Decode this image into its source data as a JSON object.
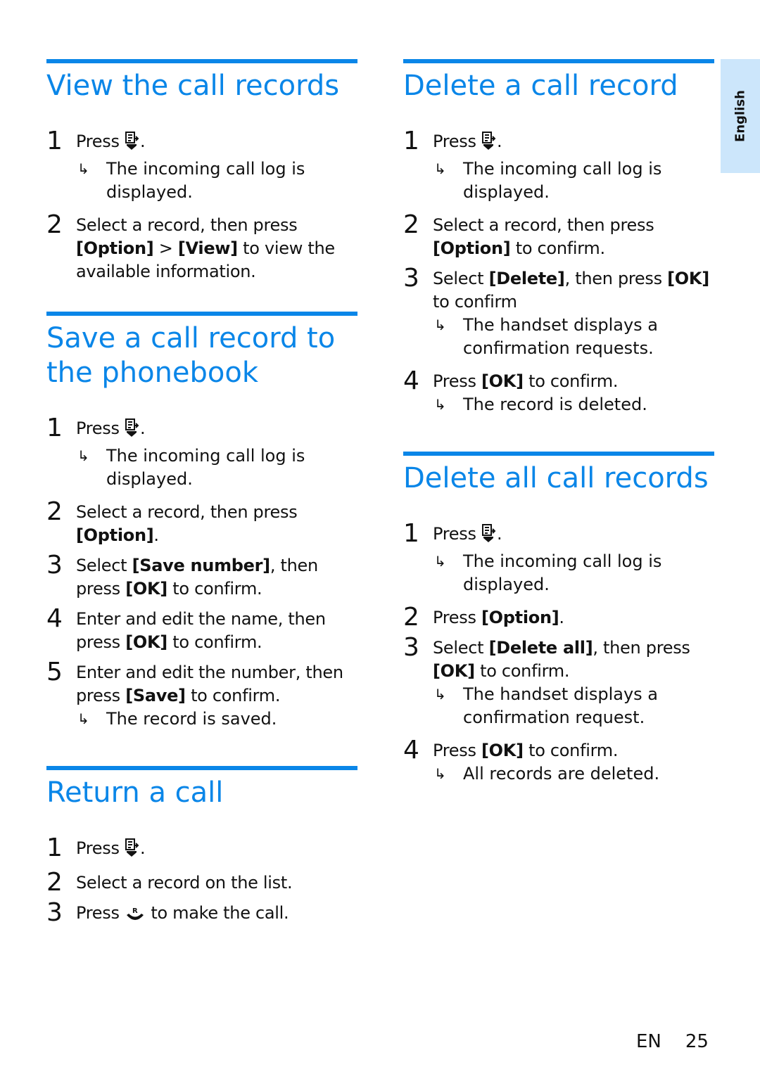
{
  "side_tab": {
    "label": "English"
  },
  "footer": {
    "lang": "EN",
    "page": "25"
  },
  "colors": {
    "accent": "#0a86e8",
    "tab_bg": "#cce6fb",
    "text": "#111111"
  },
  "icons": {
    "call_log": "call-log-icon",
    "talk": "talk-recall-icon"
  },
  "left": {
    "view": {
      "title": "View the call records",
      "steps": [
        {
          "num": "1",
          "pre": "Press ",
          "post": ".",
          "result": "The incoming call log is displayed."
        },
        {
          "num": "2",
          "t1": "Select a record, then press ",
          "b1": "[Option]",
          "t2": " > ",
          "b2": "[View]",
          "t3": " to view the available information."
        }
      ]
    },
    "save": {
      "title_line1": "Save a call record to",
      "title_line2": "the phonebook",
      "steps": [
        {
          "num": "1",
          "pre": "Press ",
          "post": ".",
          "result": "The incoming call log is displayed."
        },
        {
          "num": "2",
          "t1": "Select a record, then press ",
          "b1": "[Option]",
          "t2": "."
        },
        {
          "num": "3",
          "t1": "Select ",
          "b1": "[Save number]",
          "t2": ", then press ",
          "b2": "[OK]",
          "t3": " to confirm."
        },
        {
          "num": "4",
          "t1": "Enter and edit the name, then press ",
          "b1": "[OK]",
          "t2": " to confirm."
        },
        {
          "num": "5",
          "t1": "Enter and edit the number, then press ",
          "b1": "[Save]",
          "t2": " to confirm.",
          "result": "The record is saved."
        }
      ]
    },
    "return": {
      "title": "Return a call",
      "steps": [
        {
          "num": "1",
          "pre": "Press ",
          "post": "."
        },
        {
          "num": "2",
          "t1": "Select a record on the list."
        },
        {
          "num": "3",
          "pre": "Press ",
          "post": " to make the call."
        }
      ]
    }
  },
  "right": {
    "delete_one": {
      "title": "Delete a call record",
      "steps": [
        {
          "num": "1",
          "pre": "Press ",
          "post": ".",
          "result": "The incoming call log is displayed."
        },
        {
          "num": "2",
          "t1": "Select a record, then press ",
          "b1": "[Option]",
          "t2": " to confirm."
        },
        {
          "num": "3",
          "t1": "Select ",
          "b1": "[Delete]",
          "t2": ", then press ",
          "b2": "[OK]",
          "t3": " to confirm",
          "result": "The handset displays a confirmation requests."
        },
        {
          "num": "4",
          "t1": "Press ",
          "b1": "[OK]",
          "t2": " to confirm.",
          "result": "The record is deleted."
        }
      ]
    },
    "delete_all": {
      "title": "Delete all call records",
      "steps": [
        {
          "num": "1",
          "pre": "Press ",
          "post": ".",
          "result": "The incoming call log is displayed."
        },
        {
          "num": "2",
          "t1": "Press ",
          "b1": "[Option]",
          "t2": "."
        },
        {
          "num": "3",
          "t1": "Select ",
          "b1": "[Delete all]",
          "t2": ", then press ",
          "b2": "[OK]",
          "t3": " to confirm.",
          "result": "The handset displays a confirmation request."
        },
        {
          "num": "4",
          "t1": "Press ",
          "b1": "[OK]",
          "t2": " to confirm.",
          "result": "All records are deleted."
        }
      ]
    }
  }
}
